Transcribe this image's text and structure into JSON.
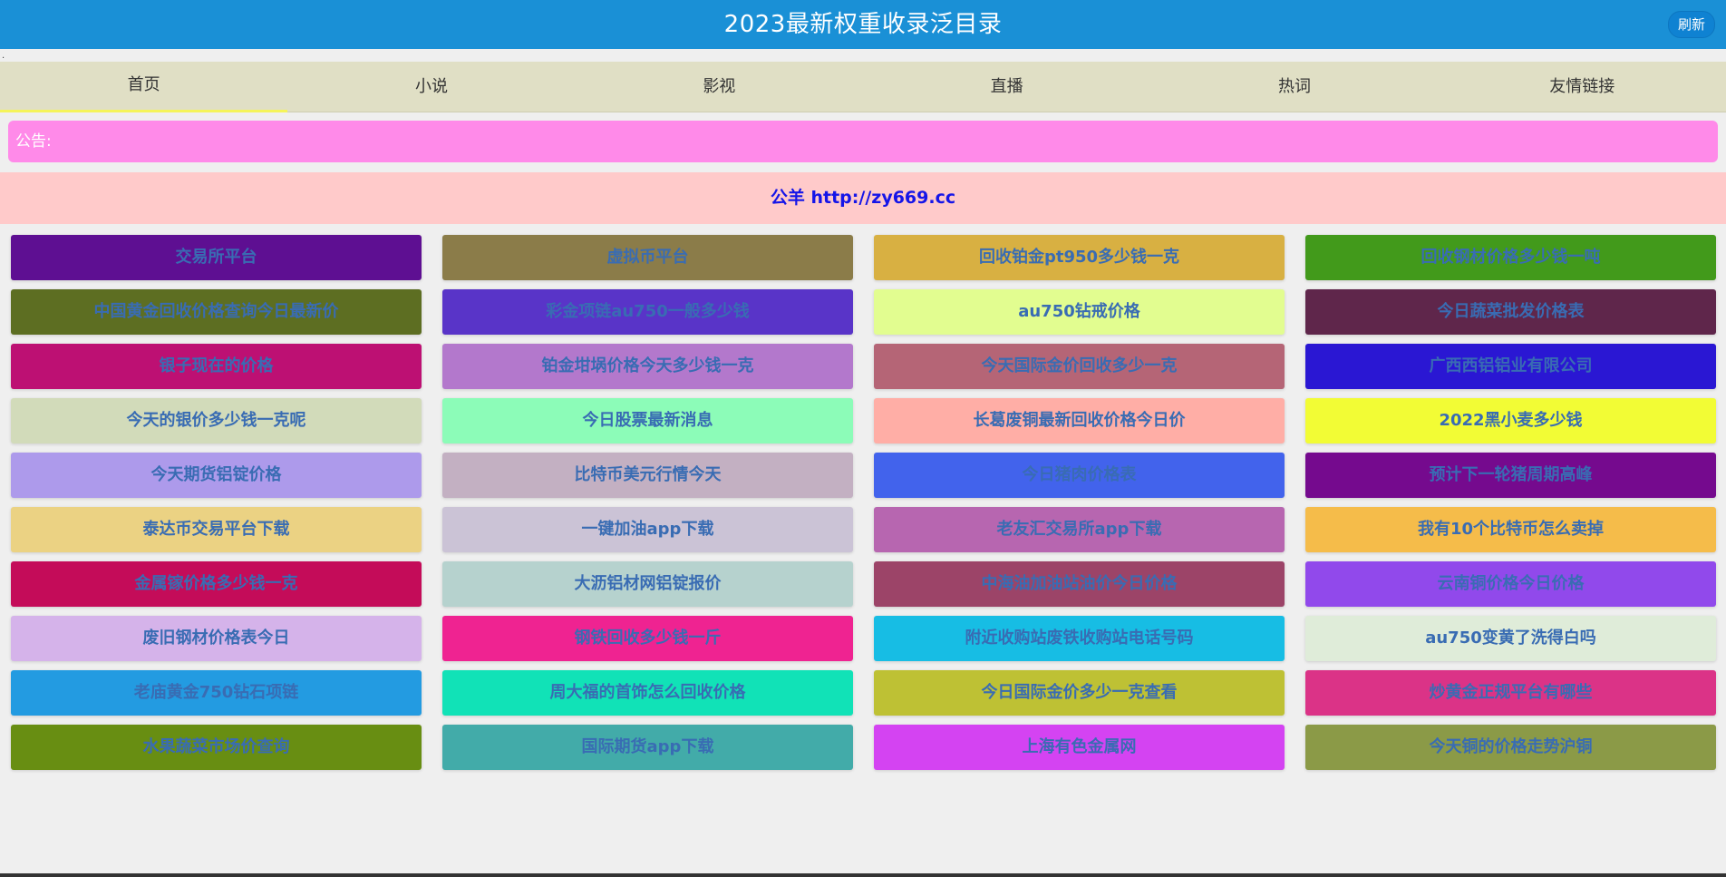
{
  "header": {
    "title": "2023最新权重收录泛目录",
    "refresh_label": "刷新"
  },
  "dot_text": ".",
  "nav": {
    "tabs": [
      {
        "label": "首页",
        "active": true
      },
      {
        "label": "小说",
        "active": false
      },
      {
        "label": "影视",
        "active": false
      },
      {
        "label": "直播",
        "active": false
      },
      {
        "label": "热词",
        "active": false
      },
      {
        "label": "友情链接",
        "active": false
      }
    ]
  },
  "notice": {
    "label": "公告:"
  },
  "banner": {
    "text": "公羊 http://zy669.cc"
  },
  "cards": [
    {
      "label": "交易所平台",
      "bg": "#5e0f92"
    },
    {
      "label": "虚拟币平台",
      "bg": "#8b7c49"
    },
    {
      "label": "回收铂金pt950多少钱一克",
      "bg": "#d8b042"
    },
    {
      "label": "回收钢材价格多少钱一吨",
      "bg": "#429a1b"
    },
    {
      "label": "中国黄金回收价格查询今日最新价",
      "bg": "#5d6e22"
    },
    {
      "label": "彩金项链au750一般多少钱",
      "bg": "#5934c8"
    },
    {
      "label": "au750钻戒价格",
      "bg": "#e2fd90"
    },
    {
      "label": "今日蔬菜批发价格表",
      "bg": "#5f264b"
    },
    {
      "label": "银子现在的价格",
      "bg": "#bd1073"
    },
    {
      "label": "铂金坩埚价格今天多少钱一克",
      "bg": "#b378cc"
    },
    {
      "label": "今天国际金价回收多少一克",
      "bg": "#b56576"
    },
    {
      "label": "广西西铝铝业有限公司",
      "bg": "#2a17d3"
    },
    {
      "label": "今天的银价多少钱一克呢",
      "bg": "#d2dbba"
    },
    {
      "label": "今日股票最新消息",
      "bg": "#8cfcb8"
    },
    {
      "label": "长葛废铜最新回收价格今日价",
      "bg": "#ffaea6"
    },
    {
      "label": "2022黑小麦多少钱",
      "bg": "#f2fc35"
    },
    {
      "label": "今天期货铝锭价格",
      "bg": "#ad9aeb"
    },
    {
      "label": "比特币美元行情今天",
      "bg": "#c3b0c2"
    },
    {
      "label": "今日猪肉价格表",
      "bg": "#4263ec"
    },
    {
      "label": "预计下一轮猪周期高峰",
      "bg": "#750a8e"
    },
    {
      "label": "泰达币交易平台下载",
      "bg": "#ebd283"
    },
    {
      "label": "一键加油app下载",
      "bg": "#cbc3d6"
    },
    {
      "label": "老友汇交易所app下载",
      "bg": "#b766b0"
    },
    {
      "label": "我有10个比特币怎么卖掉",
      "bg": "#f5bc4a"
    },
    {
      "label": "金属镓价格多少钱一克",
      "bg": "#c40c59"
    },
    {
      "label": "大沥铝材网铝锭报价",
      "bg": "#b6d2ce"
    },
    {
      "label": "中海油加油站油价今日价格",
      "bg": "#9c4468"
    },
    {
      "label": "云南铜价格今日价格",
      "bg": "#9149eb"
    },
    {
      "label": "废旧钢材价格表今日",
      "bg": "#d5b3ea"
    },
    {
      "label": "钢铁回收多少钱一斤",
      "bg": "#ef2391"
    },
    {
      "label": "附近收购站废铁收购站电话号码",
      "bg": "#17bde4"
    },
    {
      "label": "au750变黄了洗得白吗",
      "bg": "#dfecd9"
    },
    {
      "label": "老庙黄金750钻石项链",
      "bg": "#239be1"
    },
    {
      "label": "周大福的首饰怎么回收价格",
      "bg": "#11e2b7"
    },
    {
      "label": "今日国际金价多少一克查看",
      "bg": "#bec134"
    },
    {
      "label": "炒黄金正规平台有哪些",
      "bg": "#db3387"
    },
    {
      "label": "水果蔬菜市场价查询",
      "bg": "#688e12"
    },
    {
      "label": "国际期货app下载",
      "bg": "#42aba9"
    },
    {
      "label": "上海有色金属网",
      "bg": "#d443f2"
    },
    {
      "label": "今天铜的价格走势沪铜",
      "bg": "#8b9a47"
    }
  ]
}
